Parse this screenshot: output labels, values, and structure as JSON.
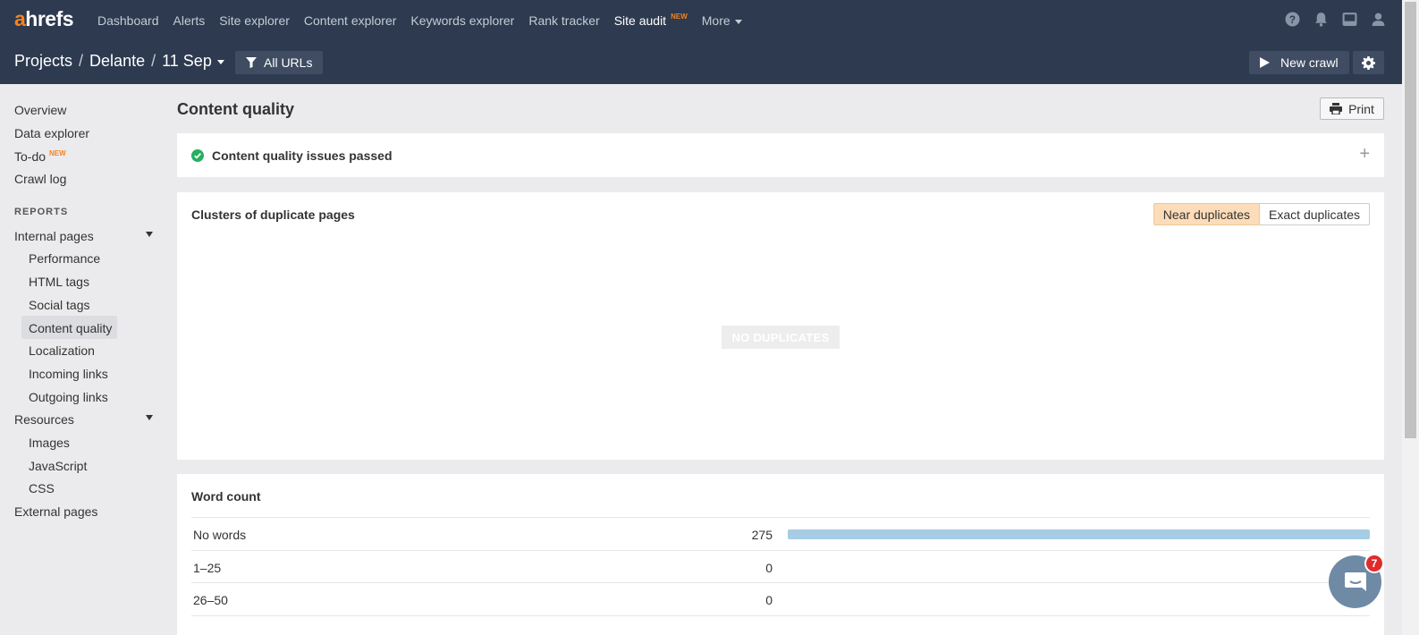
{
  "app": {
    "logo_first": "a",
    "logo_rest": "hrefs",
    "nav": [
      {
        "label": "Dashboard"
      },
      {
        "label": "Alerts"
      },
      {
        "label": "Site explorer"
      },
      {
        "label": "Content explorer"
      },
      {
        "label": "Keywords explorer"
      },
      {
        "label": "Rank tracker"
      },
      {
        "label": "Site audit",
        "badge": "NEW"
      },
      {
        "label": "More"
      }
    ],
    "icons": [
      "help-icon",
      "bell-icon",
      "inbox-icon",
      "user-icon"
    ]
  },
  "breadcrumb": {
    "projects": "Projects",
    "project": "Delante",
    "crawl": "11 Sep",
    "filter": "All URLs"
  },
  "actions": {
    "new_crawl": "New crawl",
    "print": "Print"
  },
  "sidebar": {
    "top_items": [
      "Overview",
      "Data explorer",
      "To-do",
      "Crawl log"
    ],
    "todo_badge": "NEW",
    "reports_header": "REPORTS",
    "internal_pages": "Internal pages",
    "internal_sub": [
      "Performance",
      "HTML tags",
      "Social tags",
      "Content quality",
      "Localization",
      "Incoming links",
      "Outgoing links"
    ],
    "resources": "Resources",
    "resources_sub": [
      "Images",
      "JavaScript",
      "CSS"
    ],
    "external_pages": "External pages",
    "selected": "Content quality"
  },
  "main": {
    "title": "Content quality",
    "passed_text": "Content quality issues passed",
    "duplicates": {
      "title": "Clusters of duplicate pages",
      "near": "Near duplicates",
      "exact": "Exact duplicates",
      "empty": "NO DUPLICATES"
    },
    "word_count": {
      "title": "Word count",
      "rows": [
        {
          "label": "No words",
          "value": "275",
          "fill": 1.0
        },
        {
          "label": "1–25",
          "value": "0",
          "fill": 0
        },
        {
          "label": "26–50",
          "value": "0",
          "fill": 0
        }
      ]
    }
  },
  "chat": {
    "badge": "7"
  },
  "colors": {
    "nav_bg": "#2d3a4f",
    "accent": "#f5821f",
    "bar": "#a6cde3",
    "toggle_on": "#fddcb9",
    "success": "#27ae60"
  }
}
